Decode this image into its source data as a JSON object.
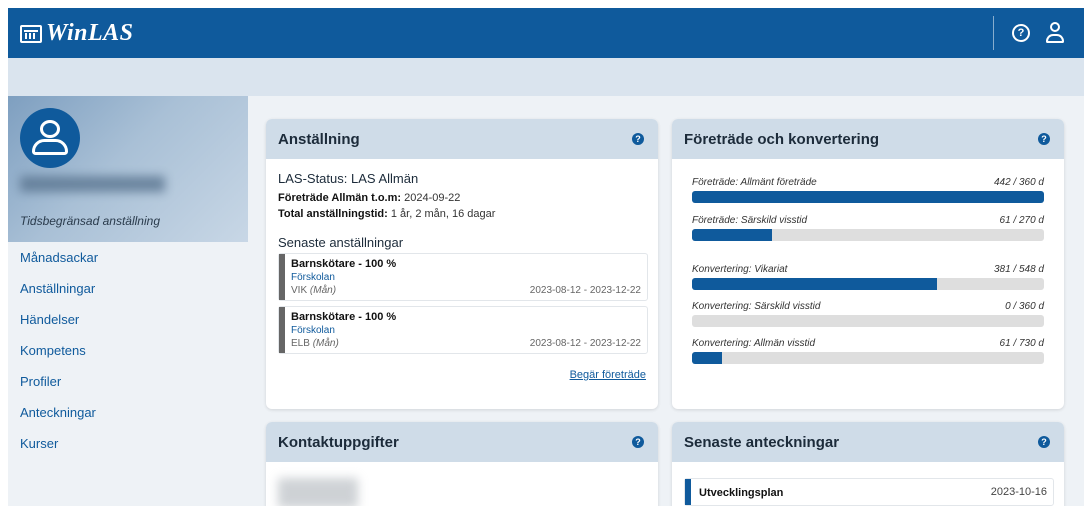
{
  "app": {
    "logo_text": "WinLAS"
  },
  "topbar": {
    "help_icon": "?"
  },
  "sidebar": {
    "employment_type": "Tidsbegränsad anställning",
    "items": [
      {
        "label": "Månadsackar"
      },
      {
        "label": "Anställningar"
      },
      {
        "label": "Händelser"
      },
      {
        "label": "Kompetens"
      },
      {
        "label": "Profiler"
      },
      {
        "label": "Anteckningar"
      },
      {
        "label": "Kurser"
      }
    ]
  },
  "employment": {
    "title": "Anställning",
    "las_status": "LAS-Status: LAS Allmän",
    "preference_label": "Företräde Allmän t.o.m:",
    "preference_value": "2024-09-22",
    "total_label": "Total anställningstid:",
    "total_value": "1 år, 2 mån, 16 dagar",
    "recent_title": "Senaste anställningar",
    "recent": [
      {
        "title": "Barnskötare - 100 %",
        "unit": "Förskolan",
        "code": "VIK",
        "code_suffix": "(Mån)",
        "dates": "2023-08-12 - 2023-12-22"
      },
      {
        "title": "Barnskötare - 100 %",
        "unit": "Förskolan",
        "code": "ELB",
        "code_suffix": "(Mån)",
        "dates": "2023-08-12 - 2023-12-22"
      }
    ],
    "request_link": "Begär företräde"
  },
  "conversion": {
    "title": "Företräde och konvertering",
    "items": [
      {
        "label": "Företräde: Allmänt företräde",
        "value": "442 / 360 d",
        "fraction": 1.0
      },
      {
        "label": "Företräde: Särskild visstid",
        "value": "61 / 270 d",
        "fraction": 0.226
      },
      {
        "label": "Konvertering: Vikariat",
        "value": "381 / 548 d",
        "fraction": 0.695
      },
      {
        "label": "Konvertering: Särskild visstid",
        "value": "0 / 360 d",
        "fraction": 0
      },
      {
        "label": "Konvertering: Allmän visstid",
        "value": "61 / 730 d",
        "fraction": 0.084
      }
    ]
  },
  "contact": {
    "title": "Kontaktuppgifter"
  },
  "notes": {
    "title": "Senaste anteckningar",
    "items": [
      {
        "title": "Utvecklingsplan",
        "date": "2023-10-16"
      }
    ]
  },
  "colors": {
    "brand": "#0f5a9c",
    "accent_bg": "#cfdce8"
  }
}
